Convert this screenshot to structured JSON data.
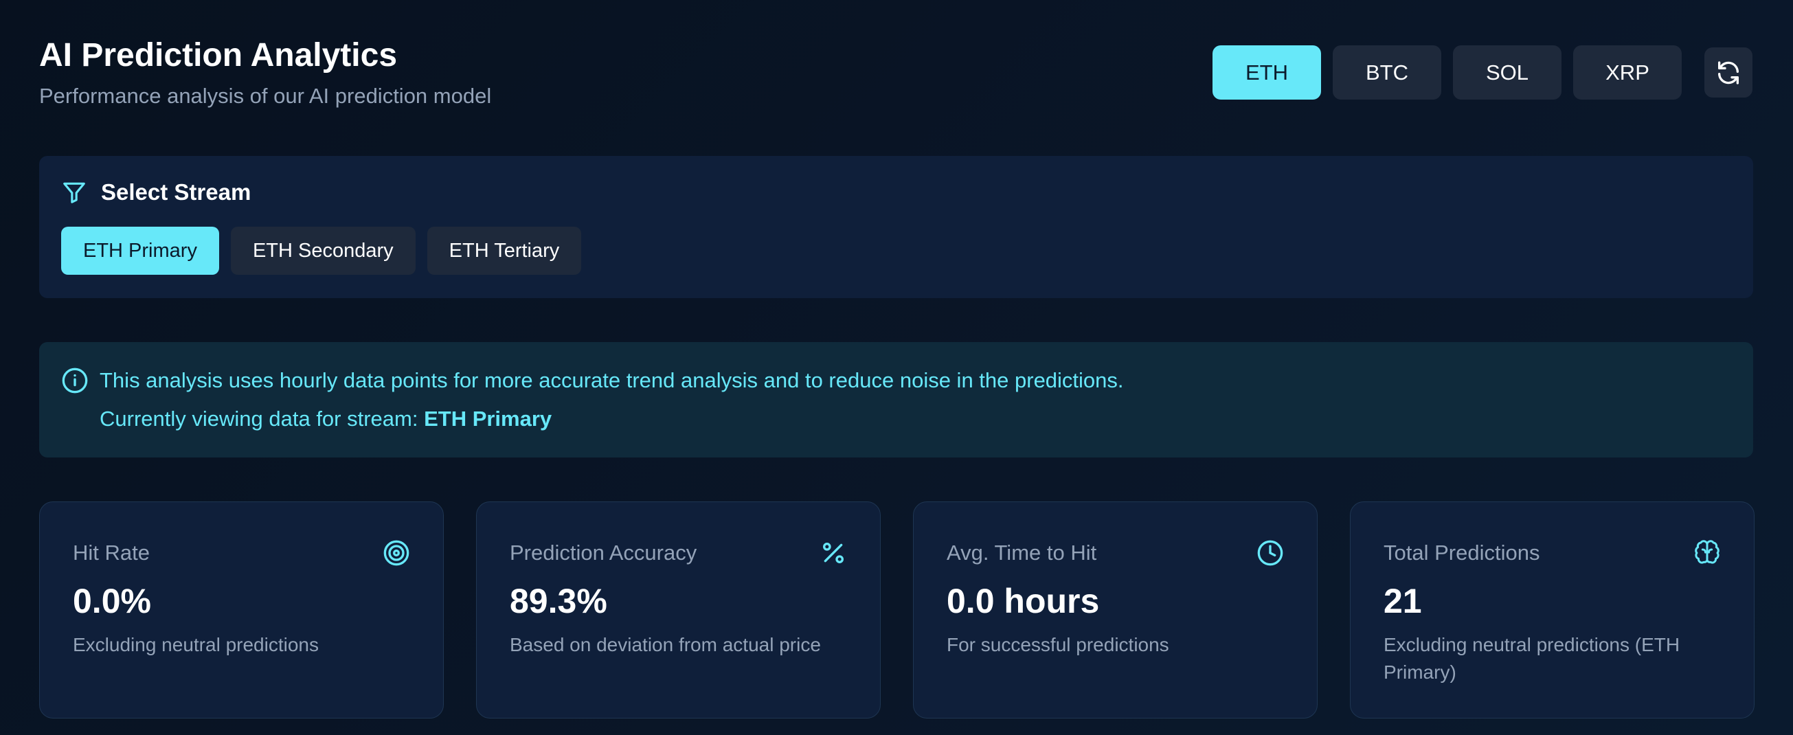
{
  "header": {
    "title": "AI Prediction Analytics",
    "subtitle": "Performance analysis of our AI prediction model"
  },
  "asset_tabs": [
    {
      "label": "ETH",
      "active": true
    },
    {
      "label": "BTC",
      "active": false
    },
    {
      "label": "SOL",
      "active": false
    },
    {
      "label": "XRP",
      "active": false
    }
  ],
  "refresh_icon": "refresh-icon",
  "stream_selector": {
    "heading": "Select Stream",
    "icon": "filter-icon",
    "streams": [
      {
        "label": "ETH Primary",
        "active": true
      },
      {
        "label": "ETH Secondary",
        "active": false
      },
      {
        "label": "ETH Tertiary",
        "active": false
      }
    ]
  },
  "info": {
    "icon": "info-icon",
    "message": "This analysis uses hourly data points for more accurate trend analysis and to reduce noise in the predictions.",
    "stream_prefix": "Currently viewing data for stream: ",
    "stream_name": "ETH Primary"
  },
  "stats": [
    {
      "title": "Hit Rate",
      "value": "0.0%",
      "description": "Excluding neutral predictions",
      "icon": "target-icon"
    },
    {
      "title": "Prediction Accuracy",
      "value": "89.3%",
      "description": "Based on deviation from actual price",
      "icon": "percent-icon"
    },
    {
      "title": "Avg. Time to Hit",
      "value": "0.0 hours",
      "description": "For successful predictions",
      "icon": "clock-icon"
    },
    {
      "title": "Total Predictions",
      "value": "21",
      "description": "Excluding neutral predictions (ETH Primary)",
      "icon": "brain-icon"
    }
  ],
  "colors": {
    "accent": "#67e8f9",
    "background": "#07111f",
    "panel": "#0f1f3a",
    "muted_text": "#94a3b8"
  }
}
